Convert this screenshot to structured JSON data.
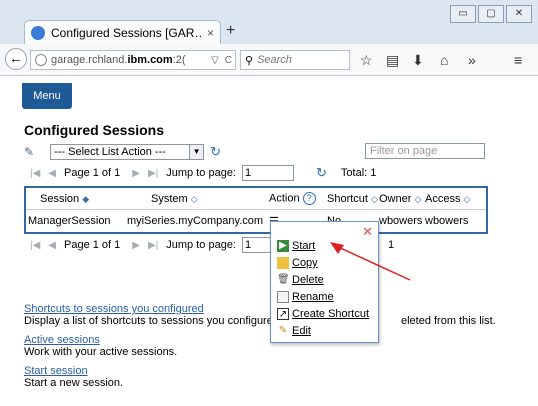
{
  "browser": {
    "tab_title": "Configured Sessions [GAR…",
    "tab_close": "×",
    "new_tab": "+",
    "url_prefix": "garage.rchland.",
    "url_bold": "ibm.com",
    "url_suffix": ":2(",
    "search_placeholder": "Search",
    "window_buttons": [
      "▭",
      "▢",
      "✕"
    ]
  },
  "page": {
    "menu_label": "Menu",
    "title": "Configured Sessions",
    "select_action": "--- Select List Action ---",
    "filter_placeholder": "Filter on page",
    "pager_top": {
      "page_info": "Page 1 of 1",
      "jump_label": "Jump to page:",
      "jump_value": "1",
      "total": "Total: 1"
    },
    "pager_bottom": {
      "page_info": "Page 1 of 1",
      "jump_label": "Jump to page:",
      "jump_value": "1",
      "total_fragment": "1"
    },
    "grid": {
      "headers": [
        "Session",
        "System",
        "Action",
        "Shortcut",
        "Owner",
        "Access"
      ],
      "row": {
        "session": "ManagerSession",
        "system": "myiSeries.myCompany.com",
        "action": "",
        "shortcut": "No",
        "owner": "wbowers",
        "access": "wbowers"
      }
    },
    "links": [
      {
        "label": "Shortcuts to sessions you configured",
        "desc": "Display a list of shortcuts to sessions you configured",
        "desc_tail": "eleted from this list."
      },
      {
        "label": "Active sessions",
        "desc": "Work with your active sessions."
      },
      {
        "label": "Start session",
        "desc": "Start a new session."
      }
    ]
  },
  "context_menu": {
    "close": "✕",
    "items": [
      "Start",
      "Copy",
      "Delete",
      "Rename",
      "Create Shortcut",
      "Edit"
    ]
  },
  "colors": {
    "accent": "#1e5b96",
    "grid_border": "#2f6aa3",
    "arrow": "#e02020"
  }
}
